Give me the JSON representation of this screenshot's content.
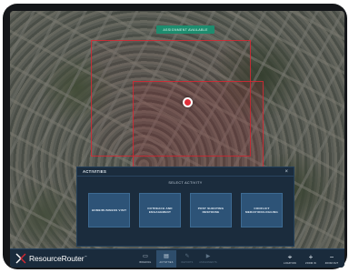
{
  "map": {
    "badge_text": "ASSIGNMENT AVAILABLE"
  },
  "panel": {
    "title": "ACTIVITIES",
    "close_symbol": "×",
    "subtitle": "SELECT ACTIVITY",
    "options": [
      {
        "label": "HOME/BUSINESS VISIT"
      },
      {
        "label": "OUTREACH AND ENGAGEMENT"
      },
      {
        "label": "POST SHOOTING RESPONSE"
      },
      {
        "label": "CONFLICT MEDIATION/LOGGING"
      }
    ]
  },
  "toolbar": {
    "brand_name": "ResourceRouter",
    "brand_tm": "™",
    "tools": [
      {
        "label": "BRIEFING",
        "icon": "briefing-icon",
        "glyph": "▭"
      },
      {
        "label": "ACTIVITIES",
        "icon": "activities-icon",
        "glyph": "▤"
      },
      {
        "label": "REPORTS",
        "icon": "pencil-icon",
        "glyph": "✎"
      },
      {
        "label": "ASSIGNMENTS",
        "icon": "play-skip-icon",
        "glyph": "▶"
      }
    ],
    "right_tools": [
      {
        "label": "LOCATION",
        "icon": "location-signal-icon",
        "glyph": "⌖"
      },
      {
        "label": "ZOOM IN",
        "icon": "plus-icon",
        "glyph": "+"
      },
      {
        "label": "ZOOM OUT",
        "icon": "minus-icon",
        "glyph": "−"
      }
    ]
  },
  "colors": {
    "zone": "#d72832",
    "pin": "#e0303a",
    "panel": "#1b2c3d",
    "card": "#2d5377",
    "badge": "#1e8c6e"
  }
}
